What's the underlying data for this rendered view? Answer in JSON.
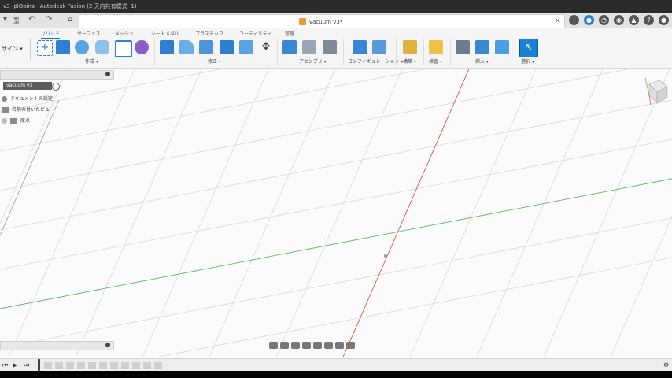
{
  "window": {
    "title": "v3- plOpins - Autodesk Fusion (2 天内共有模式 -1)"
  },
  "document": {
    "name": "vacuum v3*"
  },
  "toolbar": {
    "workspace": "ザイン ▾",
    "tabs": [
      "ソリッド",
      "サーフェス",
      "メッシュ",
      "シートメタル",
      "プラスチック",
      "ユーティリティ",
      "管理"
    ],
    "groups": [
      "作成 ▾",
      "修正 ▾",
      "アセンブリ ▾",
      "コンフィギュレーション ▾",
      "構築 ▾",
      "検査 ▾",
      "挿入 ▾",
      "選択 ▾"
    ]
  },
  "browser": {
    "root": "vacuum v3",
    "items": [
      "ドキュメントの設定",
      "名前の付いたビュー",
      "原点"
    ]
  },
  "icons": {
    "save": "save-icon",
    "undo": "undo-icon",
    "redo": "redo-icon",
    "home": "home-icon",
    "add": "plus-icon",
    "help": "help-icon",
    "notifications": "bell-icon",
    "account": "user-icon"
  },
  "colors": {
    "accent": "#1a6fc4",
    "x_axis": "#d9534f",
    "y_axis": "#5cb85c",
    "grid": "#d7d7d7"
  }
}
